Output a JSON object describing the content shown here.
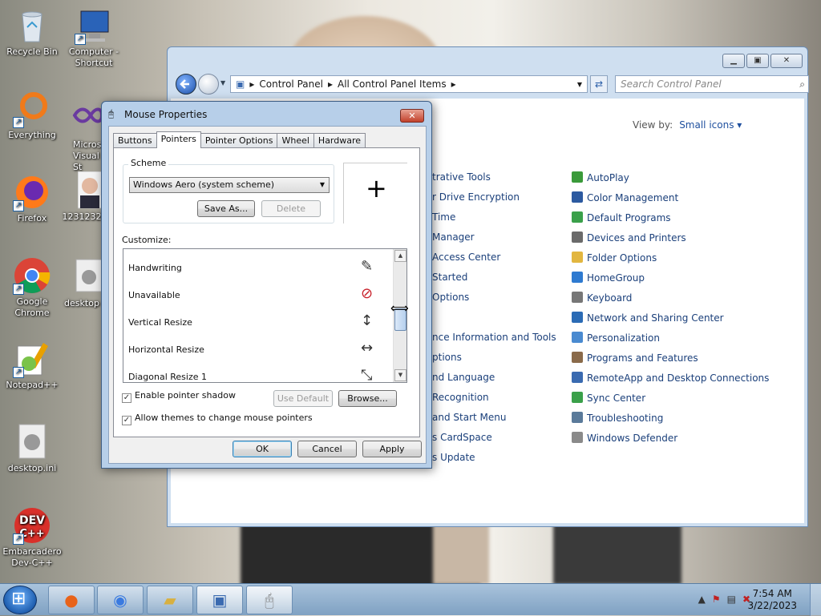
{
  "desktop": {
    "icons": [
      {
        "label": "Recycle Bin",
        "icon": "recycle-bin-icon"
      },
      {
        "label": "Computer - Shortcut",
        "icon": "computer-icon"
      },
      {
        "label": "Everything",
        "icon": "everything-icon"
      },
      {
        "label": "Micros Visual St",
        "icon": "visual-studio-icon"
      },
      {
        "label": "Firefox",
        "icon": "firefox-icon"
      },
      {
        "label": "1231232",
        "icon": "photo-icon"
      },
      {
        "label": "Google Chrome",
        "icon": "chrome-icon"
      },
      {
        "label": "desktop",
        "icon": "settings-file-icon"
      },
      {
        "label": "Notepad++",
        "icon": "notepadpp-icon"
      },
      {
        "label": "desktop.ini",
        "icon": "settings-file-icon"
      },
      {
        "label": "Embarcadero Dev-C++",
        "icon": "devcpp-icon"
      }
    ]
  },
  "control_panel": {
    "breadcrumb": [
      "Control Panel",
      "All Control Panel Items"
    ],
    "search_placeholder": "Search Control Panel",
    "view_by_label": "View by:",
    "view_by_value": "Small icons",
    "left_items": [
      "trative Tools",
      "r Drive Encryption",
      " Time",
      "Manager",
      "Access Center",
      "Started",
      "Options",
      "",
      "nce Information and Tools",
      "ptions",
      "nd Language",
      "Recognition",
      "and Start Menu",
      "s CardSpace",
      "s Update"
    ],
    "right_items": [
      {
        "label": "AutoPlay",
        "color": "#3a9a3a"
      },
      {
        "label": "Color Management",
        "color": "#2c5aa0"
      },
      {
        "label": "Default Programs",
        "color": "#3aa04a"
      },
      {
        "label": "Devices and Printers",
        "color": "#6a6a6a"
      },
      {
        "label": "Folder Options",
        "color": "#e2b640"
      },
      {
        "label": "HomeGroup",
        "color": "#2e7ad0"
      },
      {
        "label": "Keyboard",
        "color": "#777777"
      },
      {
        "label": "Network and Sharing Center",
        "color": "#2b6bb5"
      },
      {
        "label": "Personalization",
        "color": "#4a8ad0"
      },
      {
        "label": "Programs and Features",
        "color": "#8a6a4a"
      },
      {
        "label": "RemoteApp and Desktop Connections",
        "color": "#3a6ab0"
      },
      {
        "label": "Sync Center",
        "color": "#3aa04a"
      },
      {
        "label": "Troubleshooting",
        "color": "#5a7a9a"
      },
      {
        "label": "Windows Defender",
        "color": "#8a8a8a"
      }
    ]
  },
  "mouse_dialog": {
    "title": "Mouse Properties",
    "tabs": [
      "Buttons",
      "Pointers",
      "Pointer Options",
      "Wheel",
      "Hardware"
    ],
    "active_tab": "Pointers",
    "scheme_label": "Scheme",
    "scheme_value": "Windows Aero (system scheme)",
    "save_as": "Save As...",
    "delete": "Delete",
    "customize_label": "Customize:",
    "pointers": [
      {
        "label": "Handwriting",
        "glyph": "✎"
      },
      {
        "label": "Unavailable",
        "glyph": "⃠"
      },
      {
        "label": "Vertical Resize",
        "glyph": "↕"
      },
      {
        "label": "Horizontal Resize",
        "glyph": "↔"
      },
      {
        "label": "Diagonal Resize 1",
        "glyph": "⤡"
      }
    ],
    "enable_shadow": "Enable pointer shadow",
    "allow_themes": "Allow themes to change mouse pointers",
    "use_default": "Use Default",
    "browse": "Browse...",
    "ok": "OK",
    "cancel": "Cancel",
    "apply": "Apply"
  },
  "taskbar": {
    "time": "7:54 AM",
    "date": "3/22/2023"
  }
}
